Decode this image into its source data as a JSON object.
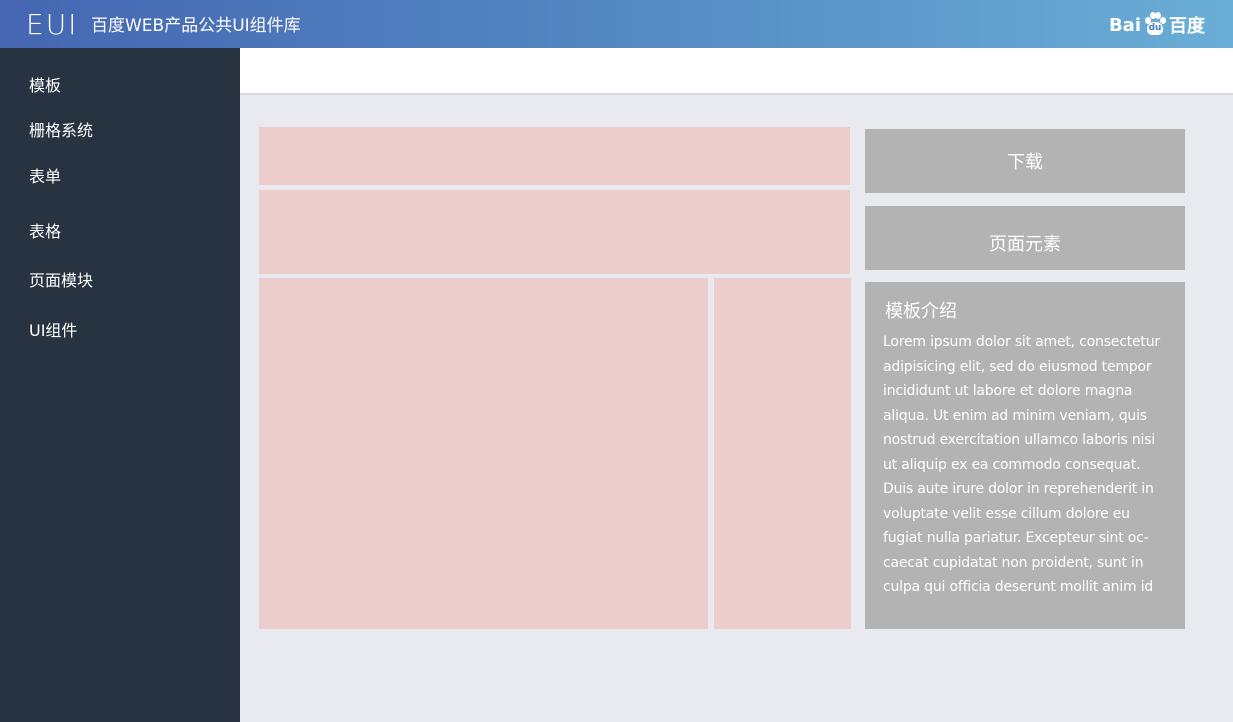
{
  "header": {
    "logo": "EUI",
    "subtitle": "百度WEB产品公共UI组件库",
    "brand_left": "Bai",
    "brand_paw": "du",
    "brand_right": "百度"
  },
  "sidebar": {
    "items": [
      {
        "label": "模板"
      },
      {
        "label": "栅格系统"
      },
      {
        "label": "表单"
      },
      {
        "label": "表格"
      },
      {
        "label": "页面模块"
      },
      {
        "label": "UI组件"
      }
    ]
  },
  "aside": {
    "download_label": "下载",
    "elements_label": "页面元素",
    "intro_title": "模板介绍",
    "intro_text": "Lorem ipsum dolor sit amet, consectetur adipisicing elit, sed do eiusmod tempor incididunt ut labore et dolore magna aliqua. Ut enim ad minim veniam, quis nostrud exercitation ullamco laboris nisi ut aliquip ex ea commodo consequat. Duis aute irure dolor in reprehenderit in voluptate velit esse cillum dolore eu fugiat nulla pariatur. Excepteur sint oc-caecat cupidatat non proident, sunt in culpa qui officia deserunt mollit anim id"
  },
  "colors": {
    "header_start": "#4566b2",
    "header_end": "#6aaed6",
    "sidebar_bg": "#273340",
    "content_bg": "#e9eaf0",
    "placeholder_block": "#edcdcb",
    "grey_panel": "#b3b3b3"
  }
}
